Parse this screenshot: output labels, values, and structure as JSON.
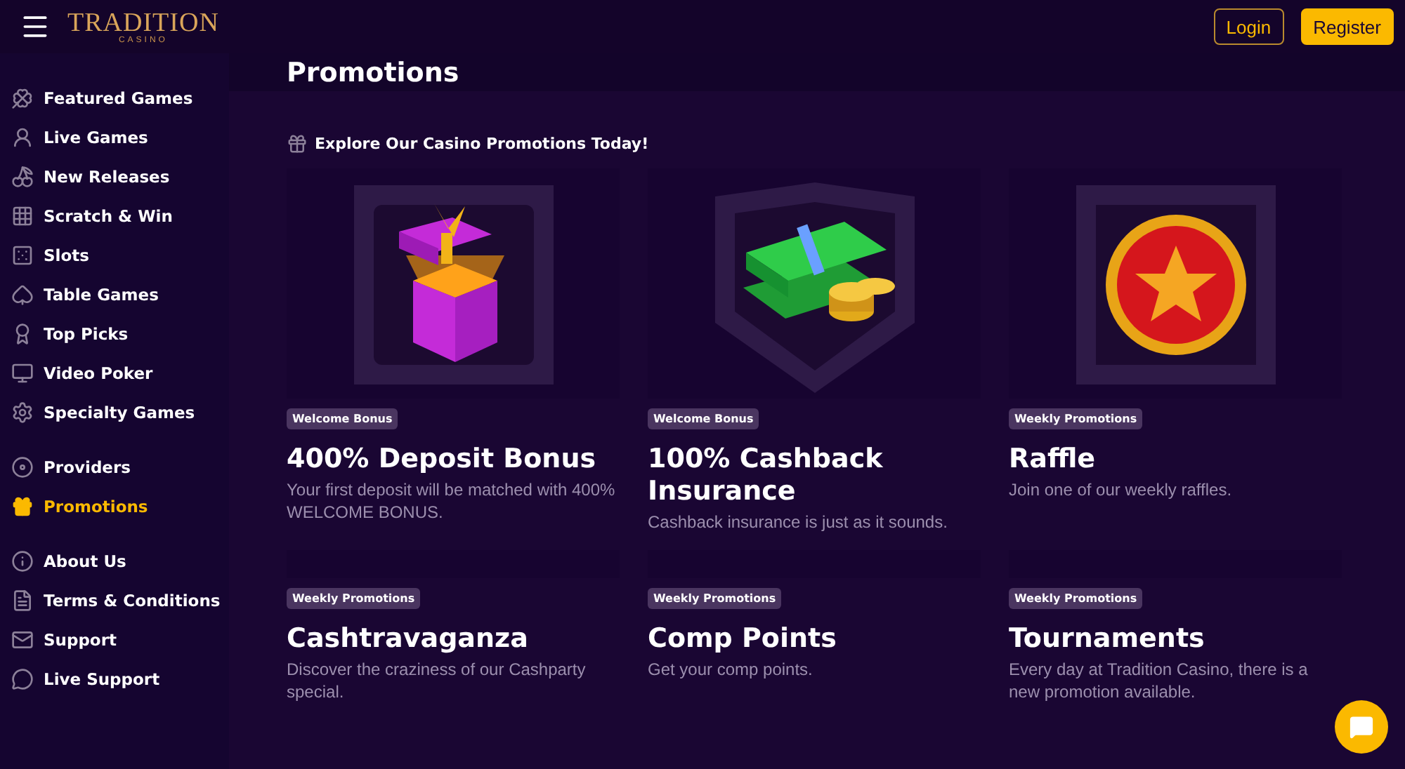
{
  "header": {
    "logo": {
      "name": "TRADITION",
      "sub": "CASINO"
    },
    "buttons": [
      {
        "label": "Login",
        "kind": "outline"
      },
      {
        "label": "Register",
        "kind": "filled"
      }
    ]
  },
  "sidebar": {
    "groups": [
      {
        "items": [
          {
            "label": "Featured Games",
            "selected": false
          },
          {
            "label": "Live Games",
            "selected": false
          },
          {
            "label": "New Releases",
            "selected": false
          },
          {
            "label": "Scratch & Win",
            "selected": false
          },
          {
            "label": "Slots",
            "selected": false
          },
          {
            "label": "Table Games",
            "selected": false
          },
          {
            "label": "Top Picks",
            "selected": false
          },
          {
            "label": "Video Poker",
            "selected": false
          },
          {
            "label": "Specialty Games",
            "selected": false
          }
        ]
      },
      {
        "items": [
          {
            "label": "Providers",
            "selected": false
          },
          {
            "label": "Promotions",
            "selected": true
          }
        ]
      },
      {
        "items": [
          {
            "label": "About Us",
            "selected": false
          },
          {
            "label": "Terms & Conditions",
            "selected": false
          },
          {
            "label": "Support",
            "selected": false
          },
          {
            "label": "Live Support",
            "selected": false
          }
        ]
      }
    ]
  },
  "page": {
    "title": "Promotions",
    "subtitle": "Explore Our Casino Promotions Today!"
  },
  "cards": [
    {
      "tag": "Welcome Bonus",
      "title": "400% Deposit Bonus",
      "description": "Your first deposit will be matched with 400% WELCOME BONUS."
    },
    {
      "tag": "Welcome Bonus",
      "title": "100% Cashback Insurance",
      "description": "Cashback insurance is just as it sounds."
    },
    {
      "tag": "Weekly Promotions",
      "title": "Raffle",
      "description": "Join one of our weekly raffles."
    },
    {
      "tag": "Weekly Promotions",
      "title": "Cashtravaganza",
      "description": "Discover the craziness of our Cashparty special."
    },
    {
      "tag": "Weekly Promotions",
      "title": "Comp Points",
      "description": "Get your comp points."
    },
    {
      "tag": "Weekly Promotions",
      "title": "Tournaments",
      "description": "Every day at Tradition Casino, there is a new promotion available."
    }
  ]
}
